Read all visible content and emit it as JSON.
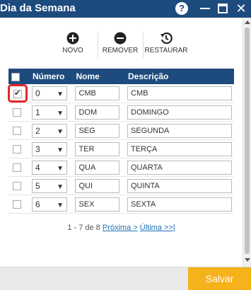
{
  "window": {
    "title": "Dia da Semana"
  },
  "toolbar": {
    "novo": "NOVO",
    "remover": "REMOVER",
    "restaurar": "RESTAURAR"
  },
  "table": {
    "headers": {
      "numero": "Número",
      "nome": "Nome",
      "descricao": "Descrição"
    },
    "rows": [
      {
        "checked": true,
        "numero": "0",
        "nome": "CMB",
        "descricao": "CMB"
      },
      {
        "checked": false,
        "numero": "1",
        "nome": "DOM",
        "descricao": "DOMINGO"
      },
      {
        "checked": false,
        "numero": "2",
        "nome": "SEG",
        "descricao": "SEGUNDA"
      },
      {
        "checked": false,
        "numero": "3",
        "nome": "TER",
        "descricao": "TERÇA"
      },
      {
        "checked": false,
        "numero": "4",
        "nome": "QUA",
        "descricao": "QUARTA"
      },
      {
        "checked": false,
        "numero": "5",
        "nome": "QUI",
        "descricao": "QUINTA"
      },
      {
        "checked": false,
        "numero": "6",
        "nome": "SEX",
        "descricao": "SEXTA"
      }
    ]
  },
  "pager": {
    "range": "1 - 7 de 8",
    "next": "Próxima >",
    "last": "Última >>|"
  },
  "footer": {
    "save": "Salvar"
  },
  "colors": {
    "primary": "#1e4b7e",
    "accent": "#f5b21a",
    "highlight": "#e3262c",
    "link": "#1e6fb5"
  }
}
